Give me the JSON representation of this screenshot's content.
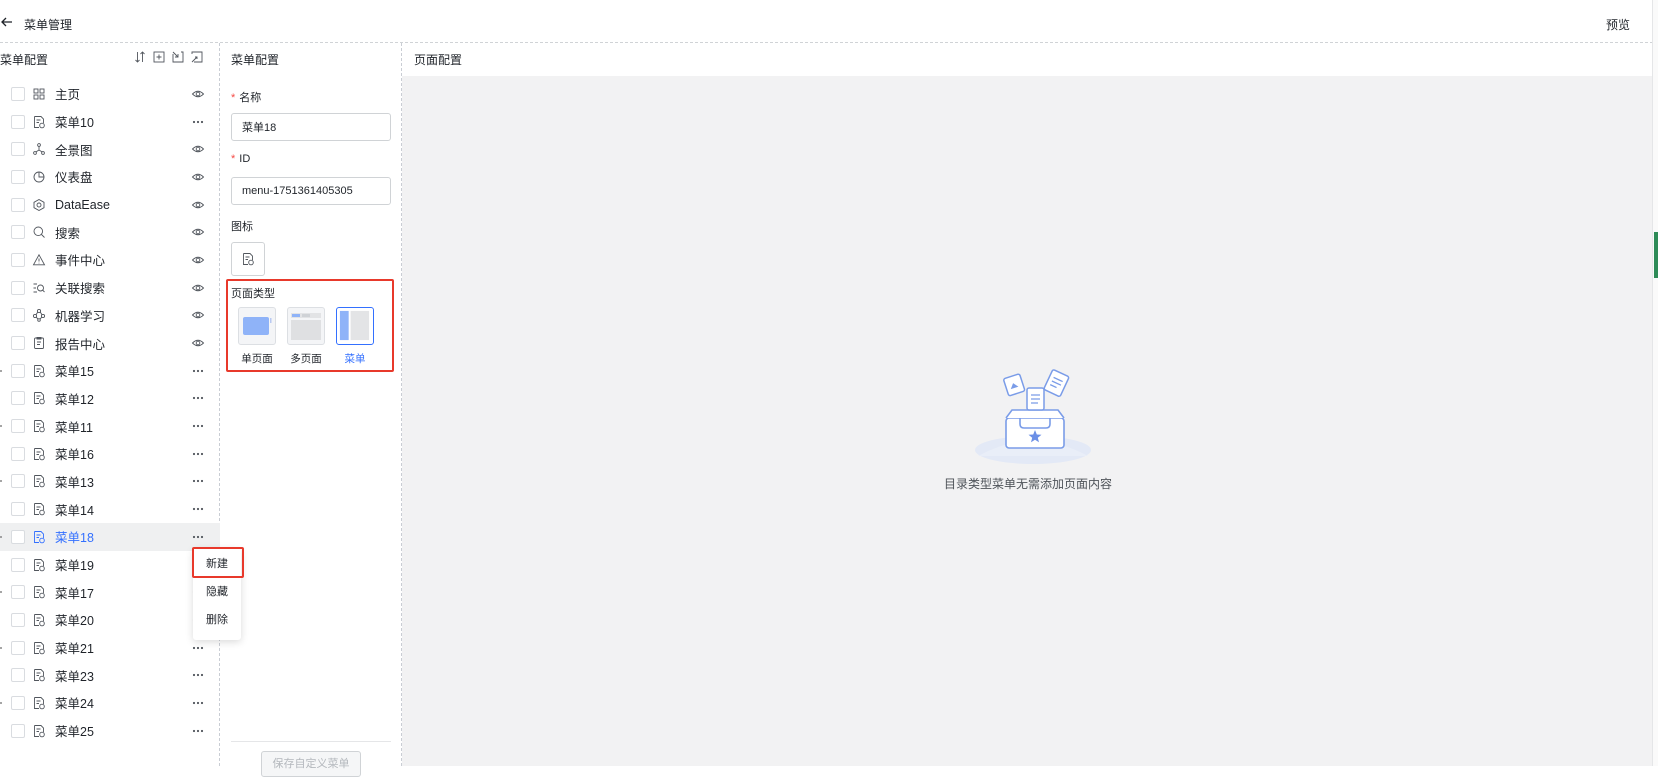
{
  "header": {
    "title": "菜单管理",
    "preview_label": "预览"
  },
  "left_panel": {
    "title": "菜单配置",
    "tools": [
      "sort-icon",
      "add-icon",
      "collapse-icon",
      "expand-icon"
    ],
    "items": [
      {
        "label": "主页",
        "icon": "grid-icon",
        "action": "eye-icon"
      },
      {
        "label": "菜单10",
        "icon": "file-icon",
        "action": "more-icon"
      },
      {
        "label": "全景图",
        "icon": "topology-icon",
        "action": "eye-icon"
      },
      {
        "label": "仪表盘",
        "icon": "pie-icon",
        "action": "eye-icon"
      },
      {
        "label": "DataEase",
        "icon": "hexagon-icon",
        "action": "eye-icon"
      },
      {
        "label": "搜索",
        "icon": "search-icon",
        "action": "eye-icon"
      },
      {
        "label": "事件中心",
        "icon": "warning-icon",
        "action": "eye-icon"
      },
      {
        "label": "关联搜索",
        "icon": "list-search-icon",
        "action": "eye-icon"
      },
      {
        "label": "机器学习",
        "icon": "nodes-icon",
        "action": "eye-icon"
      },
      {
        "label": "报告中心",
        "icon": "report-icon",
        "action": "eye-icon"
      },
      {
        "label": "菜单15",
        "icon": "file-icon",
        "action": "more-icon"
      },
      {
        "label": "菜单12",
        "icon": "file-icon",
        "action": "more-icon"
      },
      {
        "label": "菜单11",
        "icon": "file-icon",
        "action": "more-icon"
      },
      {
        "label": "菜单16",
        "icon": "file-icon",
        "action": "more-icon"
      },
      {
        "label": "菜单13",
        "icon": "file-icon",
        "action": "more-icon"
      },
      {
        "label": "菜单14",
        "icon": "file-icon",
        "action": "more-icon"
      },
      {
        "label": "菜单18",
        "icon": "file-icon",
        "action": "more-icon",
        "active": true
      },
      {
        "label": "菜单19",
        "icon": "file-icon",
        "action": "more-icon"
      },
      {
        "label": "菜单17",
        "icon": "file-icon",
        "action": "more-icon"
      },
      {
        "label": "菜单20",
        "icon": "file-icon",
        "action": "more-icon"
      },
      {
        "label": "菜单21",
        "icon": "file-icon",
        "action": "more-icon"
      },
      {
        "label": "菜单23",
        "icon": "file-icon",
        "action": "more-icon"
      },
      {
        "label": "菜单24",
        "icon": "file-icon",
        "action": "more-icon"
      },
      {
        "label": "菜单25",
        "icon": "file-icon",
        "action": "more-icon"
      }
    ]
  },
  "context_menu": {
    "items": [
      "新建",
      "隐藏",
      "删除"
    ]
  },
  "mid_panel": {
    "title": "菜单配置",
    "name_label": "名称",
    "name_value": "菜单18",
    "id_label": "ID",
    "id_value": "menu-1751361405305",
    "icon_label": "图标",
    "page_type_label": "页面类型",
    "page_types": [
      "单页面",
      "多页面",
      "菜单"
    ],
    "selected_page_type": "菜单",
    "save_button": "保存自定义菜单"
  },
  "right_panel": {
    "title": "页面配置",
    "empty_text": "目录类型菜单无需添加页面内容"
  },
  "colors": {
    "accent": "#3370ff",
    "highlight": "#e8392b",
    "canvas": "#f2f2f3"
  }
}
